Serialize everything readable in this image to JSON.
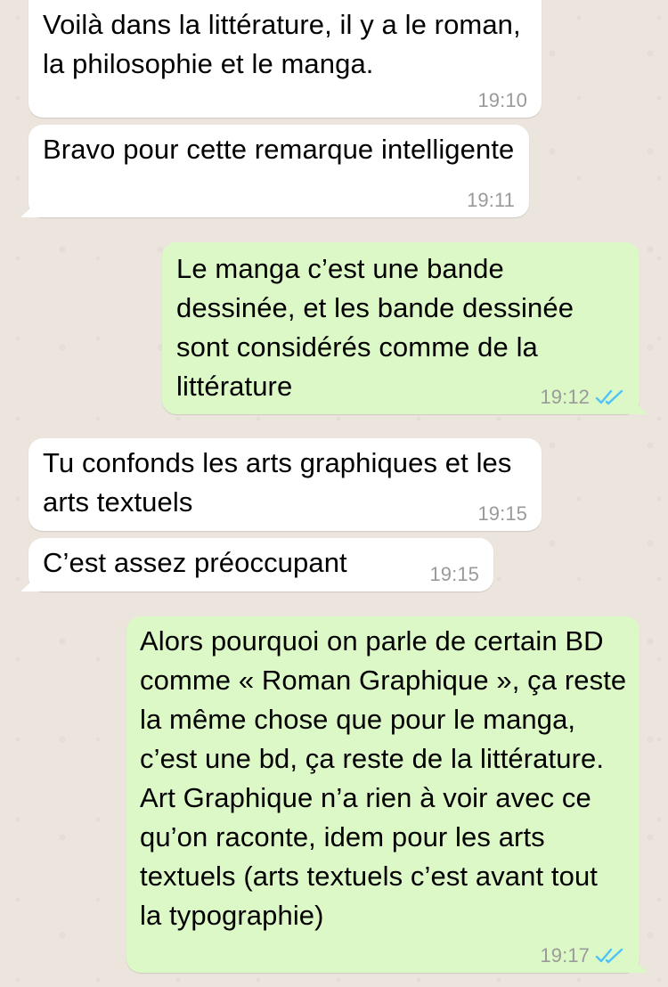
{
  "messages": [
    {
      "direction": "incoming",
      "text": "Voilà dans la littérature, il y a le roman, la philosophie et le manga.",
      "time": "19:10"
    },
    {
      "direction": "incoming",
      "text": "Bravo pour cette remarque intelligente",
      "time": "19:11"
    },
    {
      "direction": "outgoing",
      "text": "Le manga c’est une bande dessinée, et les bande dessinée sont considérés comme de la littérature",
      "time": "19:12",
      "status": "read"
    },
    {
      "direction": "incoming",
      "text": "Tu confonds les arts graphiques et les arts textuels",
      "time": "19:15"
    },
    {
      "direction": "incoming",
      "text": "C’est assez préoccupant",
      "time": "19:15"
    },
    {
      "direction": "outgoing",
      "text": "Alors pourquoi on parle de certain BD comme « Roman Graphique », ça reste la même chose que pour le manga, c’est une bd, ça reste de la littérature. Art Graphique n’a rien à voir avec ce qu’on raconte, idem pour les arts textuels (arts textuels c’est avant tout la typographie)",
      "time": "19:17",
      "status": "read"
    }
  ],
  "colors": {
    "background": "#ece5dd",
    "incoming_bubble": "#ffffff",
    "outgoing_bubble": "#dcf8c6",
    "read_ticks": "#4fc3f7"
  },
  "icons": {
    "read_status": "double-check-icon"
  }
}
